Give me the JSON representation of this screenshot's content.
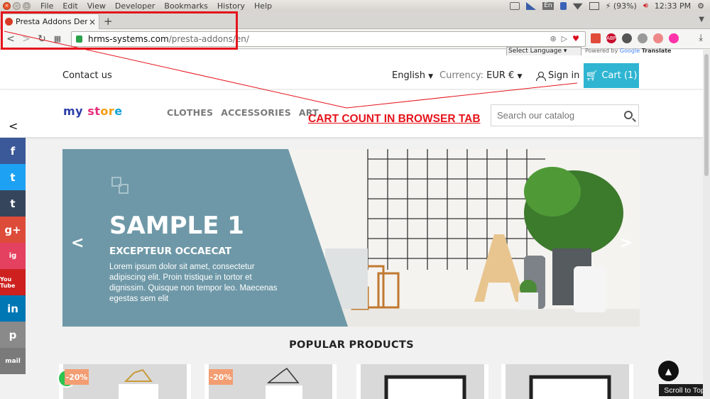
{
  "os": {
    "menus": [
      "File",
      "Edit",
      "View",
      "Developer",
      "Bookmarks",
      "History",
      "Help"
    ],
    "keyboard_layout": "En",
    "battery": "(93%)",
    "clock": "12:33 PM"
  },
  "browser": {
    "tab_title": "Presta Addons Demo",
    "new_tab": "+",
    "close_tab": "×",
    "url_host": "hrms-systems.com",
    "url_path": "/presta-addons/en/",
    "extension_abp": "ABP"
  },
  "translate": {
    "select_language": "Select Language",
    "powered_by": "Powered by",
    "google": "Google",
    "translate": "Translate"
  },
  "header": {
    "contact": "Contact us",
    "language": "English",
    "currency_label": "Currency:",
    "currency_value": "EUR €",
    "sign_in": "Sign in",
    "cart": "Cart (1)"
  },
  "logo": {
    "part1": "my",
    "part2": "st",
    "part3": "or",
    "part4": "e"
  },
  "menu": [
    "CLOTHES",
    "ACCESSORIES",
    "ART"
  ],
  "search": {
    "placeholder": "Search our catalog"
  },
  "annotation": {
    "label": "CART COUNT IN BROWSER TAB",
    "color": "#e5141c"
  },
  "social": [
    "f",
    "t",
    "t",
    "g+",
    "ig",
    "You Tube",
    "in",
    "p",
    "mail"
  ],
  "carousel": {
    "title": "SAMPLE 1",
    "subtitle": "EXCEPTEUR OCCAECAT",
    "description": "Lorem ipsum dolor sit amet, consectetur adipiscing elit. Proin tristique in tortor et dignissim. Quisque non tempor leo. Maecenas egestas sem elit",
    "panel_color": "#6e98a7"
  },
  "section_title": "POPULAR PRODUCTS",
  "products": [
    {
      "badge": "-20%"
    },
    {
      "badge": "-20%"
    },
    {
      "badge": ""
    },
    {
      "badge": ""
    }
  ],
  "scroll_to_top": "Scroll to Top",
  "colors": {
    "cart": "#2fb5d2",
    "badge": "#f39d72",
    "highlight": "#e5141c"
  }
}
